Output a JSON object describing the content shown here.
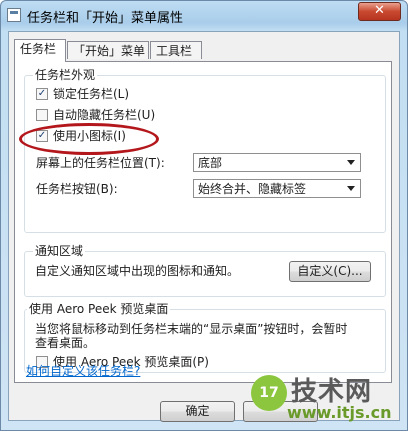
{
  "window": {
    "title": "任务栏和「开始」菜单属性",
    "close_glyph": "✕"
  },
  "tabs": [
    {
      "label": "任务栏"
    },
    {
      "label": "「开始」菜单"
    },
    {
      "label": "工具栏"
    }
  ],
  "appearance": {
    "title": "任务栏外观",
    "lock_taskbar": {
      "label": "锁定任务栏(L)",
      "checked": true
    },
    "auto_hide": {
      "label": "自动隐藏任务栏(U)",
      "checked": false
    },
    "small_icons": {
      "label": "使用小图标(I)",
      "checked": true
    },
    "location": {
      "label": "屏幕上的任务栏位置(T):",
      "value": "底部"
    },
    "buttons": {
      "label": "任务栏按钮(B):",
      "value": "始终合并、隐藏标签"
    }
  },
  "notification": {
    "title": "通知区域",
    "description": "自定义通知区域中出现的图标和通知。",
    "customize_button": "自定义(C)..."
  },
  "aero_peek": {
    "title": "使用 Aero Peek 预览桌面",
    "description_line1": "当您将鼠标移动到任务栏末端的“显示桌面”按钮时，会暂时",
    "description_line2": "查看桌面。",
    "checkbox": {
      "label": "使用 Aero Peek 预览桌面(P)",
      "checked": false
    }
  },
  "help_link": "如何自定义该任务栏?",
  "buttons": {
    "ok": "确定"
  },
  "checkmark_glyph": "✓",
  "watermark": {
    "logo": "17",
    "text": "技术网",
    "url": "www.itjs.cn"
  },
  "colors": {
    "highlight_ellipse": "#b3161b",
    "link": "#0066cc"
  }
}
